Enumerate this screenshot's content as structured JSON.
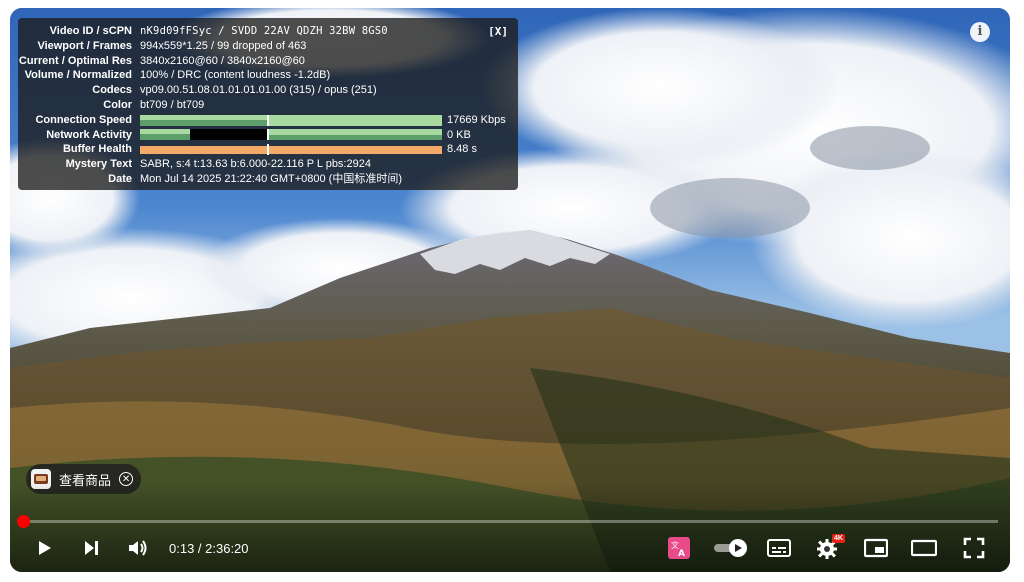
{
  "stats": {
    "close_label": "[X]",
    "rows": [
      {
        "key": "Video ID / sCPN",
        "value": "nK9d09fFSyc / SVDD 22AV QDZH 32BW 8GS0"
      },
      {
        "key": "Viewport / Frames",
        "value": "994x559*1.25 / 99 dropped of 463"
      },
      {
        "key": "Current / Optimal Res",
        "value": "3840x2160@60 / 3840x2160@60"
      },
      {
        "key": "Volume / Normalized",
        "value": "100% / DRC (content loudness -1.2dB)"
      },
      {
        "key": "Codecs",
        "value": "vp09.00.51.08.01.01.01.01.00 (315) / opus (251)"
      },
      {
        "key": "Color",
        "value": "bt709 / bt709"
      }
    ],
    "connection_speed": {
      "key": "Connection Speed",
      "value": "17669 Kbps"
    },
    "network_activity": {
      "key": "Network Activity",
      "value": "0 KB"
    },
    "buffer_health": {
      "key": "Buffer Health",
      "value": "8.48 s"
    },
    "mystery_text": {
      "key": "Mystery Text",
      "value": "SABR, s:4 t:13.63 b:6.000-22.116 P L pbs:2924"
    },
    "date": {
      "key": "Date",
      "value": "Mon Jul 14 2025 21:22:40 GMT+0800 (中国标准时间)"
    }
  },
  "info_button": "i",
  "product_chip": {
    "label": "查看商品",
    "close": "✕"
  },
  "player": {
    "time": "0:13 / 2:36:20",
    "progress_fraction": 0.0014,
    "settings_badge": "4K",
    "accent_color": "#ff0000"
  },
  "icons": [
    "play-icon",
    "next-icon",
    "volume-icon",
    "translate-icon",
    "autoplay-toggle-icon",
    "subtitles-icon",
    "settings-icon",
    "miniplayer-icon",
    "theater-icon",
    "fullscreen-icon"
  ]
}
